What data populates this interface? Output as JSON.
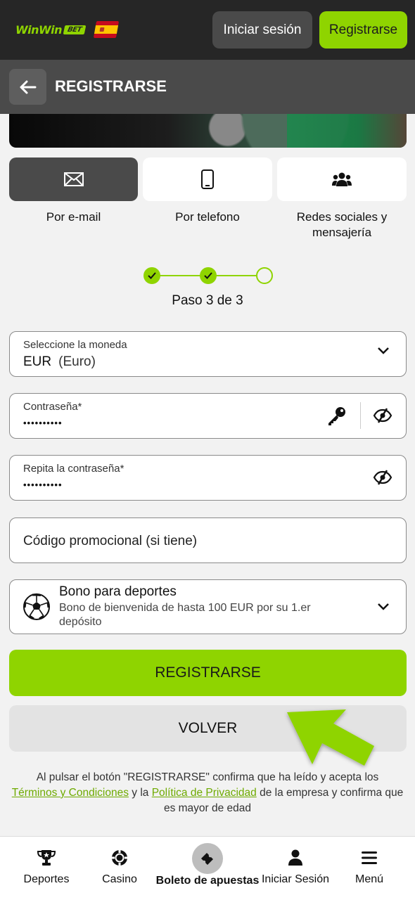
{
  "header": {
    "logo_text": "WinWin",
    "logo_badge": "BET",
    "login_label": "Iniciar sesión",
    "register_label": "Registrarse"
  },
  "subheader": {
    "title": "REGISTRARSE"
  },
  "methods": [
    {
      "label": "Por e-mail",
      "icon": "envelope-icon",
      "active": true
    },
    {
      "label": "Por telefono",
      "icon": "phone-icon",
      "active": false
    },
    {
      "label": "Redes sociales y mensajería",
      "icon": "users-icon",
      "active": false
    }
  ],
  "stepper": {
    "current": 3,
    "total": 3,
    "text": "Paso 3 de 3"
  },
  "form": {
    "currency": {
      "label": "Seleccione la moneda",
      "code": "EUR",
      "name": "(Euro)"
    },
    "password": {
      "label": "Contraseña*",
      "value": "••••••••••"
    },
    "password_repeat": {
      "label": "Repita la contraseña*",
      "value": "••••••••••"
    },
    "promo": {
      "placeholder": "Código promocional (si tiene)"
    },
    "bonus": {
      "title": "Bono para deportes",
      "description": "Bono de bienvenida de hasta 100 EUR por su 1.er depósito"
    }
  },
  "actions": {
    "register_label": "REGISTRARSE",
    "back_label": "VOLVER"
  },
  "legal": {
    "text_1": "Al pulsar el botón \"REGISTRARSE\" confirma que ha leído y acepta los",
    "terms_link": "Términos y Condiciones",
    "text_2": " y la ",
    "privacy_link": "Política de Privacidad",
    "text_3": " de la empresa y confirma que es mayor de edad"
  },
  "bottom_nav": [
    {
      "label": "Deportes",
      "icon": "trophy-icon"
    },
    {
      "label": "Casino",
      "icon": "chip-icon"
    },
    {
      "label": "Boleto de apuestas",
      "icon": "ticket-icon"
    },
    {
      "label": "Iniciar Sesión",
      "icon": "user-icon"
    },
    {
      "label": "Menú",
      "icon": "hamburger-icon"
    }
  ],
  "colors": {
    "accent": "#8fd400",
    "topbar": "#262626",
    "subheader": "#4a4a4a"
  }
}
